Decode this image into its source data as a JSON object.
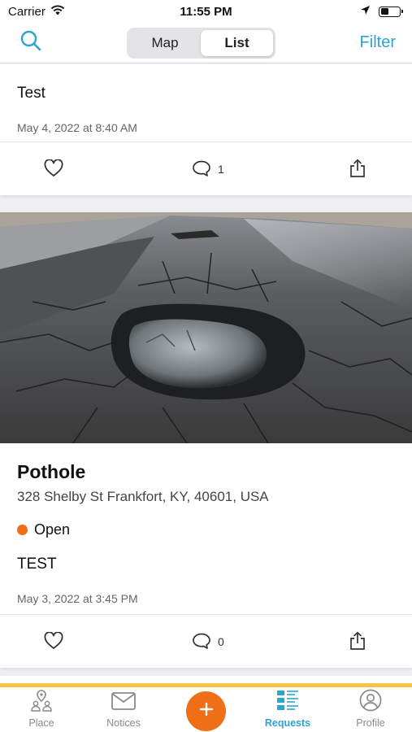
{
  "status_bar": {
    "carrier": "Carrier",
    "time": "11:55 PM"
  },
  "nav": {
    "segments": [
      "Map",
      "List"
    ],
    "active_segment": "List",
    "filter_label": "Filter"
  },
  "cards": [
    {
      "description": "Test",
      "date": "May 4, 2022 at 8:40 AM",
      "comment_count": "1"
    },
    {
      "title": "Pothole",
      "address": "328 Shelby St Frankfort, KY, 40601, USA",
      "status": "Open",
      "status_color": "#ee6f15",
      "description": "TEST",
      "date": "May 3, 2022 at 3:45 PM",
      "comment_count": "0"
    }
  ],
  "tabs": [
    {
      "label": "Place",
      "icon": "place-icon"
    },
    {
      "label": "Notices",
      "icon": "mail-icon"
    },
    {
      "label": "",
      "icon": "plus-icon"
    },
    {
      "label": "Requests",
      "icon": "list-icon",
      "active": true
    },
    {
      "label": "Profile",
      "icon": "profile-icon"
    }
  ],
  "colors": {
    "accent": "#2ba6cd",
    "add_button": "#ee6f15",
    "tab_border": "#f7c34a"
  }
}
